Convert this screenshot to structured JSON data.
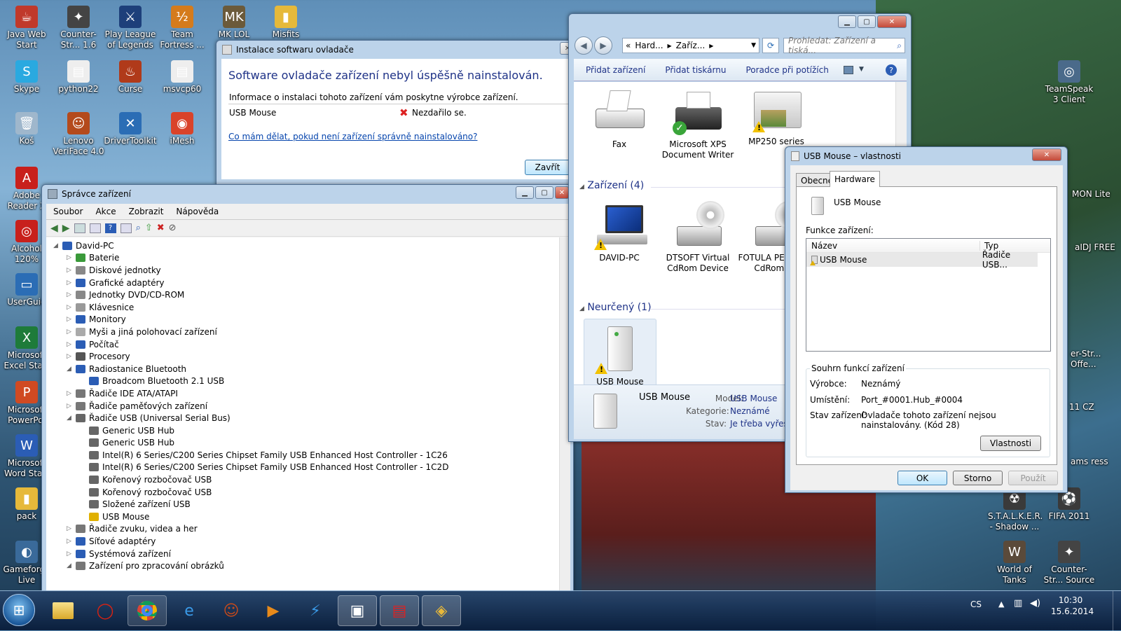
{
  "desktop_icons": [
    {
      "label": "Java Web Start",
      "color": "#c0392b",
      "glyph": "☕"
    },
    {
      "label": "Counter-Str... 1.6",
      "color": "#444",
      "glyph": "✦"
    },
    {
      "label": "Play League of Legends",
      "color": "#1d3f7a",
      "glyph": "⚔"
    },
    {
      "label": "Team Fortress ...",
      "color": "#d57b1c",
      "glyph": "½"
    },
    {
      "label": "MK LOL",
      "color": "#6b5a3a",
      "glyph": "MK"
    },
    {
      "label": "Misfits",
      "color": "#e6b93a",
      "glyph": "▮"
    },
    {
      "label": "Skype",
      "color": "#2aa9e0",
      "glyph": "S"
    },
    {
      "label": "python22",
      "color": "#eee",
      "glyph": "▤"
    },
    {
      "label": "Curse",
      "color": "#b03a1a",
      "glyph": "♨"
    },
    {
      "label": "msvcp60",
      "color": "#eee",
      "glyph": "▤"
    },
    {
      "label": "Koš",
      "color": "#9fb7cc",
      "glyph": "🗑"
    },
    {
      "label": "Lenovo VeriFace 4.0",
      "color": "#b44a1c",
      "glyph": "☺"
    },
    {
      "label": "DriverToolkit",
      "color": "#2b6db5",
      "glyph": "✕"
    },
    {
      "label": "iMesh",
      "color": "#d9432a",
      "glyph": "◉"
    },
    {
      "label": "Adobe Reader X",
      "color": "#c8201c",
      "glyph": "A"
    },
    {
      "label": "Alcohol 120%",
      "color": "#c8201c",
      "glyph": "◎"
    },
    {
      "label": "UserGuid",
      "color": "#2b6db5",
      "glyph": "▭"
    },
    {
      "label": "Microsoft Excel Start",
      "color": "#1e7b3a",
      "glyph": "X"
    },
    {
      "label": "Microsoft PowerPoi",
      "color": "#d04a22",
      "glyph": "P"
    },
    {
      "label": "Microsoft Word Start",
      "color": "#2b5db5",
      "glyph": "W"
    },
    {
      "label": "pack",
      "color": "#e6b93a",
      "glyph": "▮"
    },
    {
      "label": "Gameforge Live",
      "color": "#3a6a9a",
      "glyph": "◐"
    },
    {
      "label": "TeamSpeak 3 Client",
      "color": "#4a6a8a",
      "glyph": "◎"
    },
    {
      "label": "S.T.A.L.K.E.R. - Shadow ...",
      "color": "#3a3a3a",
      "glyph": "☢"
    },
    {
      "label": "FIFA 2011",
      "color": "#3a3a3a",
      "glyph": "⚽"
    },
    {
      "label": "World of Tanks",
      "color": "#5a4a3a",
      "glyph": "W"
    },
    {
      "label": "Counter-Str... Source",
      "color": "#444",
      "glyph": "✦"
    }
  ],
  "partial_labels": [
    "MON Lite",
    "aIDJ FREE",
    "er-Str... Offe...",
    "11 CZ",
    "ams ress"
  ],
  "driver_dialog": {
    "title": "Instalace softwaru ovladače",
    "heading": "Software ovladače zařízení nebyl úspěšně nainstalován.",
    "info": "Informace o instalaci tohoto zařízení vám poskytne výrobce zařízení.",
    "device": "USB Mouse",
    "status": "Nezdařilo se.",
    "link": "Co mám dělat, pokud není zařízení správně nainstalováno?",
    "close": "Zavřít"
  },
  "device_manager": {
    "title": "Správce zařízení",
    "menu": [
      "Soubor",
      "Akce",
      "Zobrazit",
      "Nápověda"
    ],
    "root": "David-PC",
    "items": [
      {
        "label": "Baterie",
        "level": 1,
        "exp": "closed",
        "ic": "#3a9a3a"
      },
      {
        "label": "Diskové jednotky",
        "level": 1,
        "exp": "closed",
        "ic": "#888"
      },
      {
        "label": "Grafické adaptéry",
        "level": 1,
        "exp": "closed",
        "ic": "#2b5db5"
      },
      {
        "label": "Jednotky DVD/CD-ROM",
        "level": 1,
        "exp": "closed",
        "ic": "#888"
      },
      {
        "label": "Klávesnice",
        "level": 1,
        "exp": "closed",
        "ic": "#999"
      },
      {
        "label": "Monitory",
        "level": 1,
        "exp": "closed",
        "ic": "#2b5db5"
      },
      {
        "label": "Myši a jiná polohovací zařízení",
        "level": 1,
        "exp": "closed",
        "ic": "#aaa"
      },
      {
        "label": "Počítač",
        "level": 1,
        "exp": "closed",
        "ic": "#2b5db5"
      },
      {
        "label": "Procesory",
        "level": 1,
        "exp": "closed",
        "ic": "#555"
      },
      {
        "label": "Radiostanice Bluetooth",
        "level": 1,
        "exp": "open",
        "ic": "#2b5db5"
      },
      {
        "label": "Broadcom Bluetooth 2.1 USB",
        "level": 2,
        "exp": "none",
        "ic": "#2b5db5"
      },
      {
        "label": "Řadiče IDE ATA/ATAPI",
        "level": 1,
        "exp": "closed",
        "ic": "#777"
      },
      {
        "label": "Řadiče paměťových zařízení",
        "level": 1,
        "exp": "closed",
        "ic": "#777"
      },
      {
        "label": "Řadiče USB (Universal Serial Bus)",
        "level": 1,
        "exp": "open",
        "ic": "#666"
      },
      {
        "label": "Generic USB Hub",
        "level": 2,
        "exp": "none",
        "ic": "#666"
      },
      {
        "label": "Generic USB Hub",
        "level": 2,
        "exp": "none",
        "ic": "#666"
      },
      {
        "label": "Intel(R) 6 Series/C200 Series Chipset Family USB Enhanced Host Controller - 1C26",
        "level": 2,
        "exp": "none",
        "ic": "#666"
      },
      {
        "label": "Intel(R) 6 Series/C200 Series Chipset Family USB Enhanced Host Controller - 1C2D",
        "level": 2,
        "exp": "none",
        "ic": "#666"
      },
      {
        "label": "Kořenový rozbočovač USB",
        "level": 2,
        "exp": "none",
        "ic": "#666"
      },
      {
        "label": "Kořenový rozbočovač USB",
        "level": 2,
        "exp": "none",
        "ic": "#666"
      },
      {
        "label": "Složené zařízení USB",
        "level": 2,
        "exp": "none",
        "ic": "#666"
      },
      {
        "label": "USB Mouse",
        "level": 2,
        "exp": "none",
        "ic": "#e0b000"
      },
      {
        "label": "Řadiče zvuku, videa a her",
        "level": 1,
        "exp": "closed",
        "ic": "#777"
      },
      {
        "label": "Síťové adaptéry",
        "level": 1,
        "exp": "closed",
        "ic": "#2b5db5"
      },
      {
        "label": "Systémová zařízení",
        "level": 1,
        "exp": "closed",
        "ic": "#2b5db5"
      },
      {
        "label": "Zařízení pro zpracování obrázků",
        "level": 1,
        "exp": "open",
        "ic": "#777"
      }
    ]
  },
  "devices_window": {
    "breadcrumb": [
      "Hard...",
      "Zaříz..."
    ],
    "breadcrumb_prefix": "«",
    "search_placeholder": "Prohledat: Zařízení a tiská...",
    "commands": [
      "Přidat zařízení",
      "Přidat tiskárnu",
      "Poradce při potížích"
    ],
    "printers": [
      {
        "label": "Fax"
      },
      {
        "label": "Microsoft XPS Document Writer"
      },
      {
        "label": "MP250 series"
      }
    ],
    "group_devices": "Zařízení (4)",
    "devices": [
      {
        "label": "DAVID-PC"
      },
      {
        "label": "DTSOFT Virtual CdRom Device"
      },
      {
        "label": "FOTULA PEBO1UN CdRom De"
      }
    ],
    "group_unspecified": "Neurčený (1)",
    "unspecified": [
      {
        "label": "USB Mouse"
      }
    ],
    "details": {
      "name": "USB Mouse",
      "model_label": "Model:",
      "model": "USB Mouse",
      "category_label": "Kategorie:",
      "category": "Neznámé",
      "state_label": "Stav:",
      "state": "Je třeba vyřešit"
    }
  },
  "props_dialog": {
    "title": "USB Mouse – vlastnosti",
    "tabs": [
      "Obecné",
      "Hardware"
    ],
    "device": "USB Mouse",
    "functions_label": "Funkce zařízení:",
    "col_name": "Název",
    "col_type": "Typ",
    "row_name": "USB Mouse",
    "row_type": "Řadiče USB...",
    "summary_label": "Souhrn funkcí zařízení",
    "maker_label": "Výrobce:",
    "maker": "Neznámý",
    "location_label": "Umístění:",
    "location": "Port_#0001.Hub_#0004",
    "status_label": "Stav zařízení:",
    "status": "Ovladače tohoto zařízení nejsou nainstalovány. (Kód 28)",
    "props_btn": "Vlastnosti",
    "ok": "OK",
    "cancel": "Storno",
    "apply": "Použít"
  },
  "taskbar": {
    "lang": "CS",
    "time": "10:30",
    "date": "15.6.2014"
  }
}
